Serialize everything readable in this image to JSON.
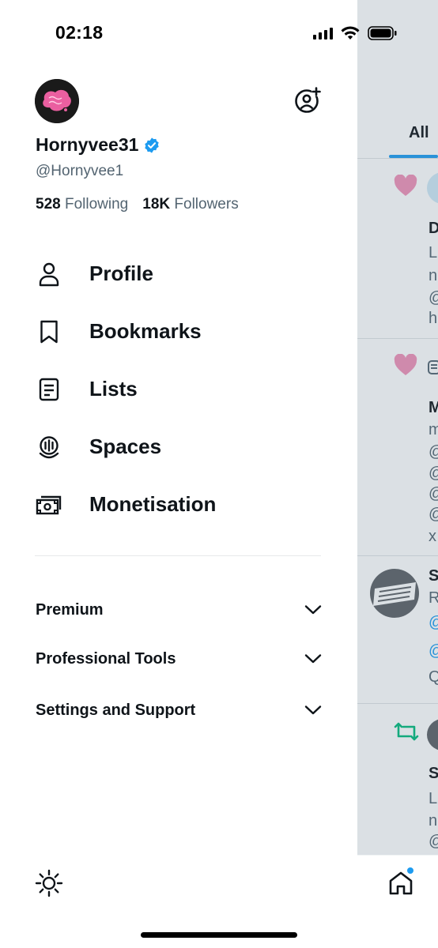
{
  "status_bar": {
    "time": "02:18"
  },
  "profile": {
    "display_name": "Hornyvee31",
    "handle": "@Hornyvee1",
    "following_count": "528",
    "following_label": "Following",
    "followers_count": "18K",
    "followers_label": "Followers"
  },
  "nav": {
    "items": [
      {
        "label": "Profile",
        "icon": "person-icon"
      },
      {
        "label": "Bookmarks",
        "icon": "bookmark-icon"
      },
      {
        "label": "Lists",
        "icon": "list-icon"
      },
      {
        "label": "Spaces",
        "icon": "spaces-icon"
      },
      {
        "label": "Monetisation",
        "icon": "money-icon"
      }
    ]
  },
  "sections": [
    {
      "label": "Premium",
      "icon": "chevron-down-icon"
    },
    {
      "label": "Professional Tools",
      "icon": "chevron-down-icon"
    },
    {
      "label": "Settings and Support",
      "icon": "chevron-down-icon"
    }
  ],
  "timeline": {
    "tab_label": "All",
    "fragments": [
      "D",
      "L",
      "n",
      "@",
      "h",
      "M",
      "m",
      "@",
      "@",
      "@",
      "@",
      "x",
      "S",
      "R",
      "@",
      "@",
      "Q",
      "S",
      "L",
      "n",
      "@"
    ]
  },
  "colors": {
    "accent": "#1d9bf0",
    "like": "#f091b8",
    "repost": "#00ba7c",
    "secondary_text": "#536471"
  }
}
